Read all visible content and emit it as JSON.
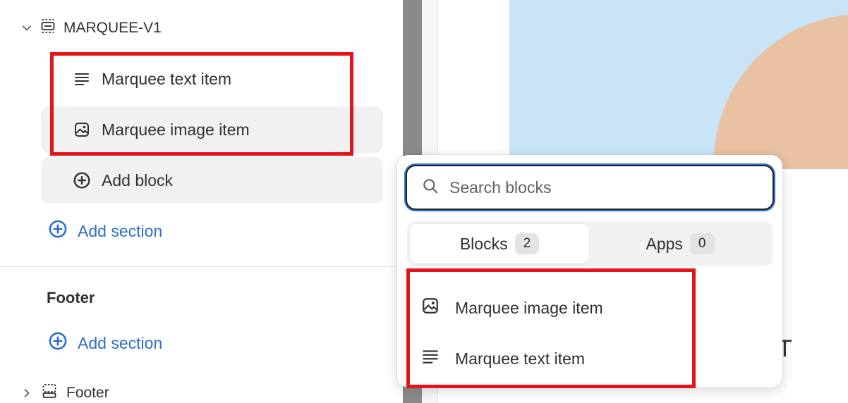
{
  "sidebar": {
    "section": {
      "label": "MARQUEE-V1",
      "icon": "section-icon",
      "expanded": true
    },
    "blocks": [
      {
        "label": "Marquee text item",
        "icon": "text-lines-icon"
      },
      {
        "label": "Marquee image item",
        "icon": "image-icon"
      }
    ],
    "add_block_label": "Add block",
    "add_section_label": "Add section",
    "footer_group": {
      "title": "Footer",
      "add_section_label": "Add section",
      "section_label": "Footer"
    }
  },
  "popup": {
    "search_placeholder": "Search blocks",
    "tabs": [
      {
        "label": "Blocks",
        "count": "2",
        "active": true
      },
      {
        "label": "Apps",
        "count": "0",
        "active": false
      }
    ],
    "items": [
      {
        "label": "Marquee image item",
        "icon": "image-icon"
      },
      {
        "label": "Marquee text item",
        "icon": "text-lines-icon"
      }
    ]
  },
  "colors": {
    "highlight": "#e5141b",
    "link": "#2c6ecb",
    "focus_ring": "#2e72d2"
  }
}
